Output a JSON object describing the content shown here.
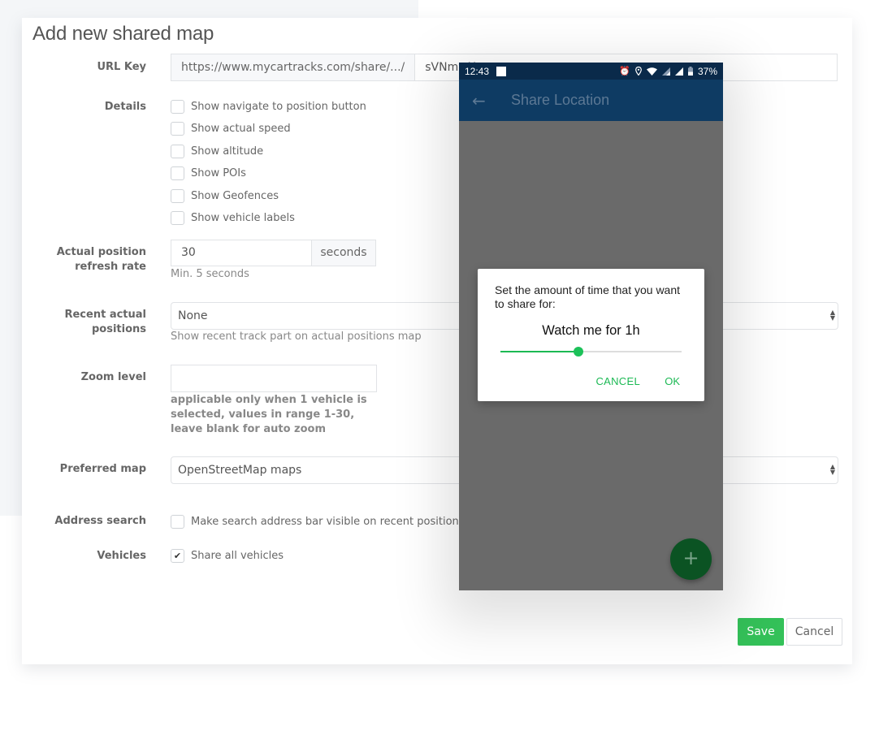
{
  "form": {
    "title": "Add new shared map",
    "url_key": {
      "label": "URL Key",
      "prefix": "https://www.mycartracks.com/share/.../",
      "value": "sVNmwH"
    },
    "details": {
      "label": "Details",
      "options": [
        {
          "label": "Show navigate to position button",
          "checked": false
        },
        {
          "label": "Show actual speed",
          "checked": false
        },
        {
          "label": "Show altitude",
          "checked": false
        },
        {
          "label": "Show POIs",
          "checked": false
        },
        {
          "label": "Show Geofences",
          "checked": false
        },
        {
          "label": "Show vehicle labels",
          "checked": false
        }
      ]
    },
    "refresh_rate": {
      "label_line1": "Actual position",
      "label_line2": "refresh rate",
      "value": "30",
      "unit": "seconds",
      "help": "Min. 5 seconds"
    },
    "recent_positions": {
      "label_line1": "Recent actual",
      "label_line2": "positions",
      "selected": "None",
      "help": "Show recent track part on actual positions map"
    },
    "zoom_level": {
      "label": "Zoom level",
      "value": "",
      "help": "applicable only when 1 vehicle is selected, values in range 1-30, leave blank for auto zoom"
    },
    "preferred_map": {
      "label": "Preferred map",
      "selected": "OpenStreetMap maps"
    },
    "address_search": {
      "label": "Address search",
      "option": "Make search address bar visible on recent positions map",
      "checked": false
    },
    "vehicles": {
      "label": "Vehicles",
      "option": "Share all vehicles",
      "checked": true
    },
    "save_label": "Save",
    "cancel_label": "Cancel"
  },
  "phone": {
    "status_bar": {
      "time": "12:43",
      "battery": "37%",
      "icons": [
        "alarm-icon",
        "location-icon",
        "wifi-icon",
        "signal-icon",
        "signal-icon",
        "battery-icon"
      ]
    },
    "app_bar": {
      "title": "Share Location",
      "back_icon": "arrow-back-icon"
    },
    "dialog": {
      "message": "Set the amount of time that you want to share for:",
      "value_label": "Watch me for 1h",
      "slider_fraction": 0.43,
      "cancel_label": "CANCEL",
      "ok_label": "OK"
    },
    "fab_icon": "plus-icon",
    "fab_symbol": "+"
  },
  "colors": {
    "accent_green": "#34c159",
    "android_green": "#1cb954",
    "appbar_blue": "#0e3b63",
    "statusbar_blue": "#0a2a4a",
    "fab_green": "#0b5323"
  }
}
